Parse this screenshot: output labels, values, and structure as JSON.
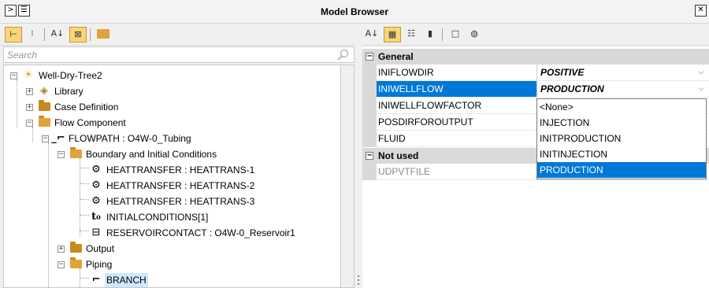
{
  "window": {
    "title": "Model Browser",
    "close_glyph": "✕"
  },
  "search": {
    "placeholder": "Search"
  },
  "tree": {
    "root": "Well-Dry-Tree2",
    "library": "Library",
    "case_definition": "Case Definition",
    "flow_component": "Flow Component",
    "flowpath": "FLOWPATH : O4W-0_Tubing",
    "boundary": "Boundary and Initial Conditions",
    "heattransfer": [
      "HEATTRANSFER : HEATTRANS-1",
      "HEATTRANSFER : HEATTRANS-2",
      "HEATTRANSFER : HEATTRANS-3"
    ],
    "initial_conditions": "INITIALCONDITIONS[1]",
    "reservoir_contact": "RESERVOIRCONTACT : O4W-0_Reservoir1",
    "output": "Output",
    "piping": "Piping",
    "branch": "BRANCH"
  },
  "properties": {
    "general_label": "General",
    "not_used_label": "Not used",
    "rows": [
      {
        "name": "INIFLOWDIR",
        "value": "POSITIVE"
      },
      {
        "name": "INIWELLFLOW",
        "value": "PRODUCTION"
      },
      {
        "name": "INIWELLFLOWFACTOR",
        "value": ""
      },
      {
        "name": "POSDIRFOROUTPUT",
        "value": ""
      },
      {
        "name": "FLUID",
        "value": ""
      }
    ],
    "unused_rows": [
      {
        "name": "UDPVTFILE",
        "value": ""
      }
    ]
  },
  "dropdown": {
    "options": [
      "<None>",
      "INJECTION",
      "INITPRODUCTION",
      "INITINJECTION",
      "PRODUCTION"
    ],
    "selected": "PRODUCTION"
  },
  "icons": {
    "left_toolbar": [
      "tree-view-icon",
      "collapse-icon",
      "sort-az-icon",
      "filter-icon",
      "folder-icon"
    ],
    "right_toolbar": [
      "sort-az-icon",
      "categorized-icon",
      "list-icon",
      "details-icon",
      "blank-icon",
      "globe-icon"
    ]
  },
  "colors": {
    "selection": "#0078d7",
    "category_bg": "#d9d9d9",
    "folder": "#c88a1e",
    "active_tool": "#f7d57a"
  }
}
